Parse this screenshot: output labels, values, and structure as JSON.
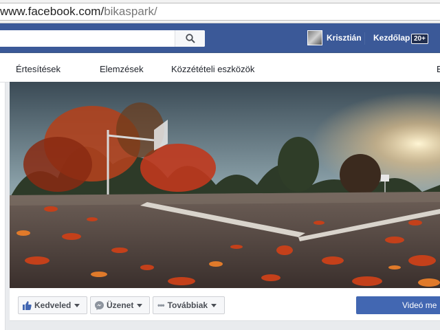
{
  "browser": {
    "url_host": "www.facebook.com/",
    "url_path": "bikaspark/"
  },
  "topbar": {
    "user_name": "Krisztián",
    "home_label": "Kezdőlap",
    "notification_count": "20+",
    "colors": {
      "bar": "#3b5998"
    }
  },
  "page_nav": {
    "items": [
      {
        "label": "Értesítések"
      },
      {
        "label": "Elemzések"
      },
      {
        "label": "Közzétételi eszközök"
      },
      {
        "label": "B"
      }
    ]
  },
  "actions": {
    "like_label": "Kedveled",
    "message_label": "Üzenet",
    "more_label": "Továbbiak",
    "cta_label": "Videó me"
  },
  "cover": {
    "description_icon": "cover-photo"
  }
}
